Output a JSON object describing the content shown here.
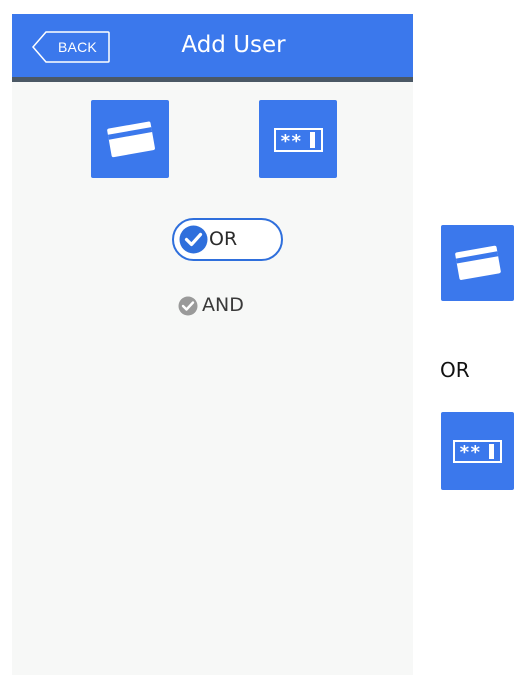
{
  "header": {
    "back_label": "BACK",
    "title": "Add User"
  },
  "methods": [
    {
      "icon": "card-icon"
    },
    {
      "icon": "password-icon"
    }
  ],
  "logic": {
    "selected": "OR",
    "options": [
      {
        "label": "OR",
        "selected": true
      },
      {
        "label": "AND",
        "selected": false
      }
    ]
  },
  "preview": {
    "first_icon": "card-icon",
    "joiner": "OR",
    "second_icon": "password-icon"
  },
  "colors": {
    "accent": "#3b78ec",
    "header_border": "#4b5865",
    "background": "#f7f8f7",
    "radio_selected": "#2f6fdc",
    "radio_unselected": "#9a9a9a"
  }
}
